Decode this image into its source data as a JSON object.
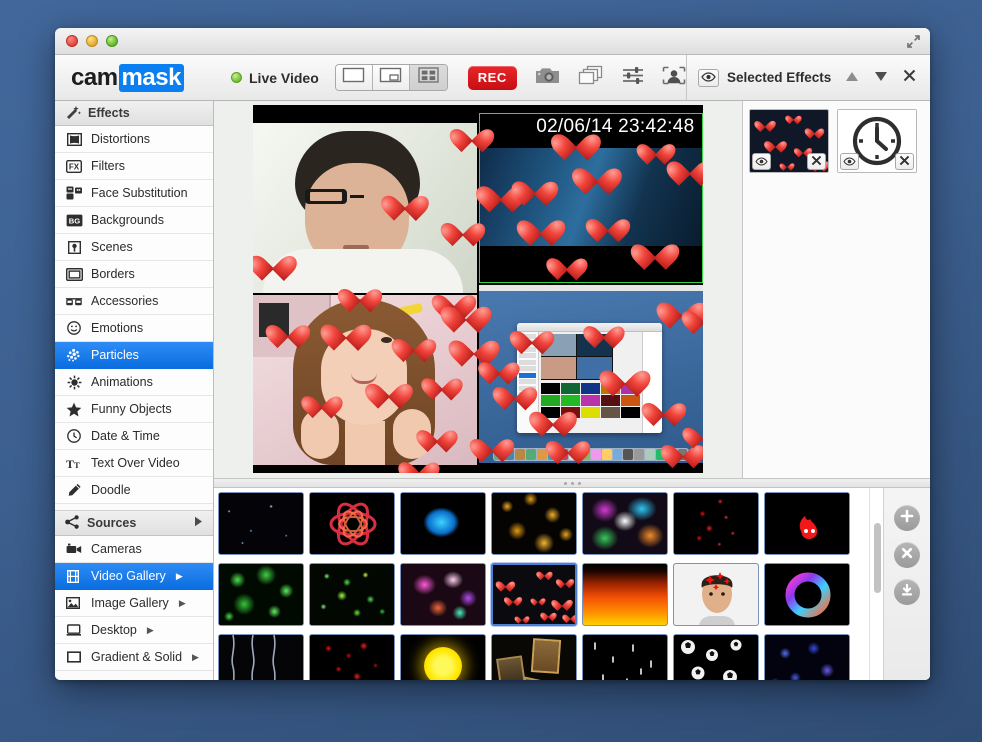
{
  "window": {
    "traffic_lights": [
      "close",
      "minimize",
      "zoom"
    ],
    "expand_icon": "expand-arrows-icon"
  },
  "toolbar": {
    "logo_part1": "cam",
    "logo_part2": "mask",
    "live_status": "Live Video",
    "live_dot_color": "#6cb92f",
    "layouts": [
      {
        "name": "single-view",
        "icon": "single-pane-icon",
        "active": false
      },
      {
        "name": "picture-in-picture-view",
        "icon": "pip-icon",
        "active": false
      },
      {
        "name": "grid-view",
        "icon": "quad-grid-icon",
        "active": true
      }
    ],
    "rec_label": "REC",
    "rec_color": "#d01418",
    "snapshot_icon": "camera-icon",
    "stack_icon": "layers-icon",
    "adjust_icon": "sliders-icon",
    "face_icon": "portrait-icon"
  },
  "selected_effects": {
    "eye_icon": "eye-icon",
    "title": "Selected Effects",
    "move_up_icon": "triangle-up-icon",
    "move_down_icon": "triangle-down-icon",
    "close_icon": "close-x-icon",
    "items": [
      {
        "name": "hearts-particles",
        "eye_icon": "eye-icon",
        "remove_icon": "close-x-icon",
        "thumb": "hearts"
      },
      {
        "name": "date-time-clock",
        "eye_icon": "eye-icon",
        "remove_icon": "close-x-icon",
        "thumb": "clock"
      }
    ]
  },
  "sidebar": {
    "effects_header": {
      "label": "Effects",
      "icon": "magic-wand-icon"
    },
    "effects_items": [
      {
        "label": "Distortions",
        "icon": "distortion-icon",
        "selected": false
      },
      {
        "label": "Filters",
        "icon": "fx-icon",
        "selected": false
      },
      {
        "label": "Face Substitution",
        "icon": "face-swap-icon",
        "selected": false
      },
      {
        "label": "Backgrounds",
        "icon": "bg-icon",
        "selected": false
      },
      {
        "label": "Scenes",
        "icon": "pin-icon",
        "selected": false
      },
      {
        "label": "Borders",
        "icon": "frame-icon",
        "selected": false
      },
      {
        "label": "Accessories",
        "icon": "glasses-icon",
        "selected": false
      },
      {
        "label": "Emotions",
        "icon": "smiley-icon",
        "selected": false
      },
      {
        "label": "Particles",
        "icon": "particles-icon",
        "selected": true
      },
      {
        "label": "Animations",
        "icon": "sparkle-icon",
        "selected": false
      },
      {
        "label": "Funny Objects",
        "icon": "star-icon",
        "selected": false
      },
      {
        "label": "Date & Time",
        "icon": "clock-icon",
        "selected": false
      },
      {
        "label": "Text Over Video",
        "icon": "text-tt-icon",
        "selected": false
      },
      {
        "label": "Doodle",
        "icon": "pencil-icon",
        "selected": false
      }
    ],
    "sources_header": {
      "label": "Sources",
      "icon": "share-node-icon",
      "disclosure_icon": "triangle-right-icon"
    },
    "sources_items": [
      {
        "label": "Cameras",
        "icon": "camcorder-icon",
        "selected": false,
        "arrow": false
      },
      {
        "label": "Video Gallery",
        "icon": "film-icon",
        "selected": true,
        "arrow": true
      },
      {
        "label": "Image Gallery",
        "icon": "photo-icon",
        "selected": false,
        "arrow": true
      },
      {
        "label": "Desktop",
        "icon": "laptop-icon",
        "selected": false,
        "arrow": true
      },
      {
        "label": "Gradient & Solid",
        "icon": "square-icon",
        "selected": false,
        "arrow": true
      }
    ]
  },
  "preview": {
    "timestamp_overlay": "02/06/14 23:42:48",
    "active_border_color": "#36d43d",
    "panes": [
      {
        "name": "webcam-man",
        "position": "top-left"
      },
      {
        "name": "video-clip-blue",
        "position": "top-right",
        "highlighted": true
      },
      {
        "name": "webcam-girl",
        "position": "bottom-left"
      },
      {
        "name": "desktop-capture",
        "position": "bottom-right"
      }
    ],
    "overlay_effect": "hearts-particles"
  },
  "splitter": {
    "grip_dots": 3
  },
  "gallery": {
    "selected_index": 10,
    "thumbnails": [
      {
        "name": "sparse-stars",
        "style": "stars"
      },
      {
        "name": "red-atom-rings",
        "style": "atom-red"
      },
      {
        "name": "blue-smoke",
        "style": "blue-blob"
      },
      {
        "name": "gold-coins",
        "style": "gold"
      },
      {
        "name": "rainbow-bokeh",
        "style": "rainbow"
      },
      {
        "name": "red-stars-falling",
        "style": "red-stars"
      },
      {
        "name": "red-flame-face",
        "style": "red-face"
      },
      {
        "name": "green-bokeh-large",
        "style": "green-big"
      },
      {
        "name": "green-confetti",
        "style": "green-small"
      },
      {
        "name": "magenta-bokeh",
        "style": "magenta"
      },
      {
        "name": "hearts",
        "style": "hearts"
      },
      {
        "name": "fire",
        "style": "fire"
      },
      {
        "name": "face-with-stars",
        "style": "face-stars"
      },
      {
        "name": "color-ring",
        "style": "color-ring"
      },
      {
        "name": "rain-streaks",
        "style": "rain"
      },
      {
        "name": "red-petals",
        "style": "red-petals"
      },
      {
        "name": "yellow-sun",
        "style": "yellow-sun"
      },
      {
        "name": "paintings",
        "style": "paintings"
      },
      {
        "name": "white-sparks",
        "style": "white-sparks"
      },
      {
        "name": "soccer-balls",
        "style": "soccer"
      },
      {
        "name": "blue-stars",
        "style": "blue-stars"
      }
    ],
    "actions": [
      {
        "name": "add-effect-button",
        "icon": "plus-icon"
      },
      {
        "name": "remove-effect-button",
        "icon": "close-x-icon"
      },
      {
        "name": "download-effect-button",
        "icon": "download-icon"
      }
    ]
  }
}
